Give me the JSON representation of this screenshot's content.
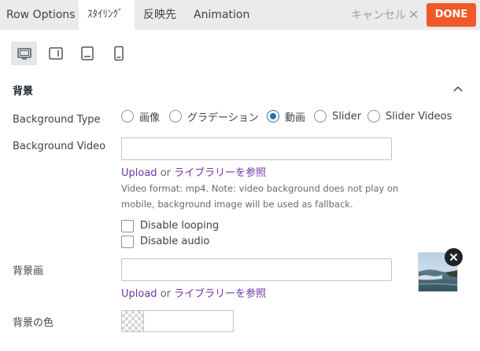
{
  "tabs": [
    {
      "label": "Row Options",
      "active": false
    },
    {
      "label": "ｽﾀｲﾘﾝｸﾞ",
      "active": true
    },
    {
      "label": "反映先",
      "active": false
    },
    {
      "label": "Animation",
      "active": false
    }
  ],
  "header": {
    "cancel_label": "キャンセル",
    "cancel_icon": "close-icon",
    "done_label": "DONE",
    "accent": "#f1582a"
  },
  "devices": [
    {
      "name": "desktop",
      "icon": "desktop-icon",
      "active": true
    },
    {
      "name": "tablet-landscape",
      "icon": "tablet-landscape-icon",
      "active": false
    },
    {
      "name": "tablet-portrait",
      "icon": "tablet-portrait-icon",
      "active": false
    },
    {
      "name": "mobile",
      "icon": "mobile-icon",
      "active": false
    }
  ],
  "section": {
    "title": "背景",
    "expanded": true
  },
  "background_type": {
    "label": "Background Type",
    "options": [
      "画像",
      "グラデーション",
      "動画",
      "Slider",
      "Slider Videos"
    ],
    "selected": "動画"
  },
  "background_video": {
    "label": "Background Video",
    "value": "",
    "upload": "Upload",
    "or": "or",
    "browse": "ライブラリーを参照",
    "help": "Video format: mp4. Note: video background does not play on mobile, background image will be used as fallback."
  },
  "options": [
    {
      "label": "Disable looping",
      "checked": false
    },
    {
      "label": "Disable audio",
      "checked": false
    }
  ],
  "background_image": {
    "label": "背景画",
    "value": "",
    "upload": "Upload",
    "or": "or",
    "browse": "ライブラリーを参照"
  },
  "background_color": {
    "label": "背景の色",
    "value": ""
  },
  "colors": {
    "radio_checked": "#2271b1",
    "link": "#6e35a8"
  }
}
